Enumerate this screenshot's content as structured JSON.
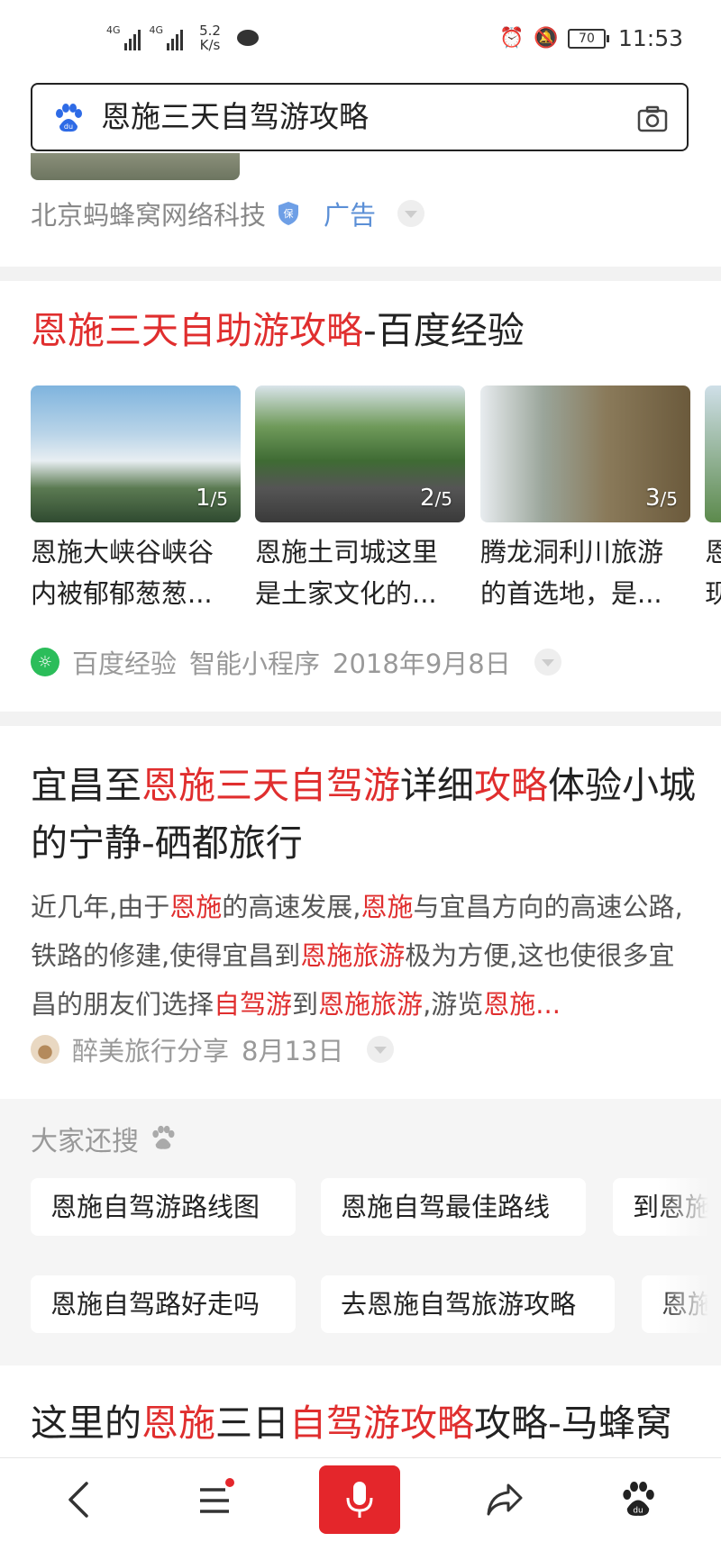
{
  "status_bar": {
    "signal1": "4G",
    "signal2": "4G",
    "speed_value": "5.2",
    "speed_unit": "K/s",
    "battery": "70",
    "time": "11:53"
  },
  "search": {
    "query": "恩施三天自驾游攻略"
  },
  "ad": {
    "source": "北京蚂蜂窝网络科技",
    "label": "广告"
  },
  "result1": {
    "title_hl": "恩施三天自助游攻略",
    "title_rest": "-百度经验",
    "thumbs": [
      {
        "index": "1",
        "total": "/5",
        "caption1": "恩施大峡谷峡谷",
        "caption2": "内被郁郁葱葱..."
      },
      {
        "index": "2",
        "total": "/5",
        "caption1": "恩施土司城这里",
        "caption2": "是土家文化的..."
      },
      {
        "index": "3",
        "total": "/5",
        "caption1": "腾龙洞利川旅游",
        "caption2": "的首选地，是..."
      },
      {
        "index": "",
        "total": "",
        "caption1": "恩",
        "caption2": "现"
      }
    ],
    "source": "百度经验",
    "mini_program": "智能小程序",
    "date": "2018年9月8日"
  },
  "result2": {
    "title_parts": [
      {
        "t": "宜昌至",
        "hl": false
      },
      {
        "t": "恩施三天自驾游",
        "hl": true
      },
      {
        "t": "详细",
        "hl": false
      },
      {
        "t": "攻略",
        "hl": true
      },
      {
        "t": "体验小城的宁静-硒都旅行",
        "hl": false
      }
    ],
    "abstract_parts": [
      {
        "t": "近几年,由于",
        "hl": false
      },
      {
        "t": "恩施",
        "hl": true
      },
      {
        "t": "的高速发展,",
        "hl": false
      },
      {
        "t": "恩施",
        "hl": true
      },
      {
        "t": "与宜昌方向的高速公路,铁路的修建,使得宜昌到",
        "hl": false
      },
      {
        "t": "恩施旅游",
        "hl": true
      },
      {
        "t": "极为方便,这也使很多宜昌的朋友们选择",
        "hl": false
      },
      {
        "t": "自驾游",
        "hl": true
      },
      {
        "t": "到",
        "hl": false
      },
      {
        "t": "恩施旅游",
        "hl": true
      },
      {
        "t": ",游览",
        "hl": false
      },
      {
        "t": "恩施...",
        "hl": true
      }
    ],
    "author": "醉美旅行分享",
    "date": "8月13日"
  },
  "related": {
    "title": "大家还搜",
    "chips": [
      "恩施自驾游路线图",
      "恩施自驾最佳路线",
      "到恩施",
      "恩施自驾路好走吗",
      "去恩施自驾旅游攻略",
      "恩施"
    ]
  },
  "result3": {
    "title_parts": [
      {
        "t": "这里的",
        "hl": false
      },
      {
        "t": "恩施",
        "hl": true
      },
      {
        "t": "三日",
        "hl": false
      },
      {
        "t": "自驾游攻略",
        "hl": true
      },
      {
        "t": "攻略-马蜂窝",
        "hl": false
      }
    ]
  },
  "colors": {
    "highlight": "#e02e2e",
    "accent_red": "#e4262b",
    "ad_blue": "#5b8fd6"
  },
  "icons": {
    "back": "chevron-left-icon",
    "menu": "menu-icon",
    "mic": "mic-icon",
    "share": "share-icon",
    "baidu": "baidu-paw-icon"
  }
}
